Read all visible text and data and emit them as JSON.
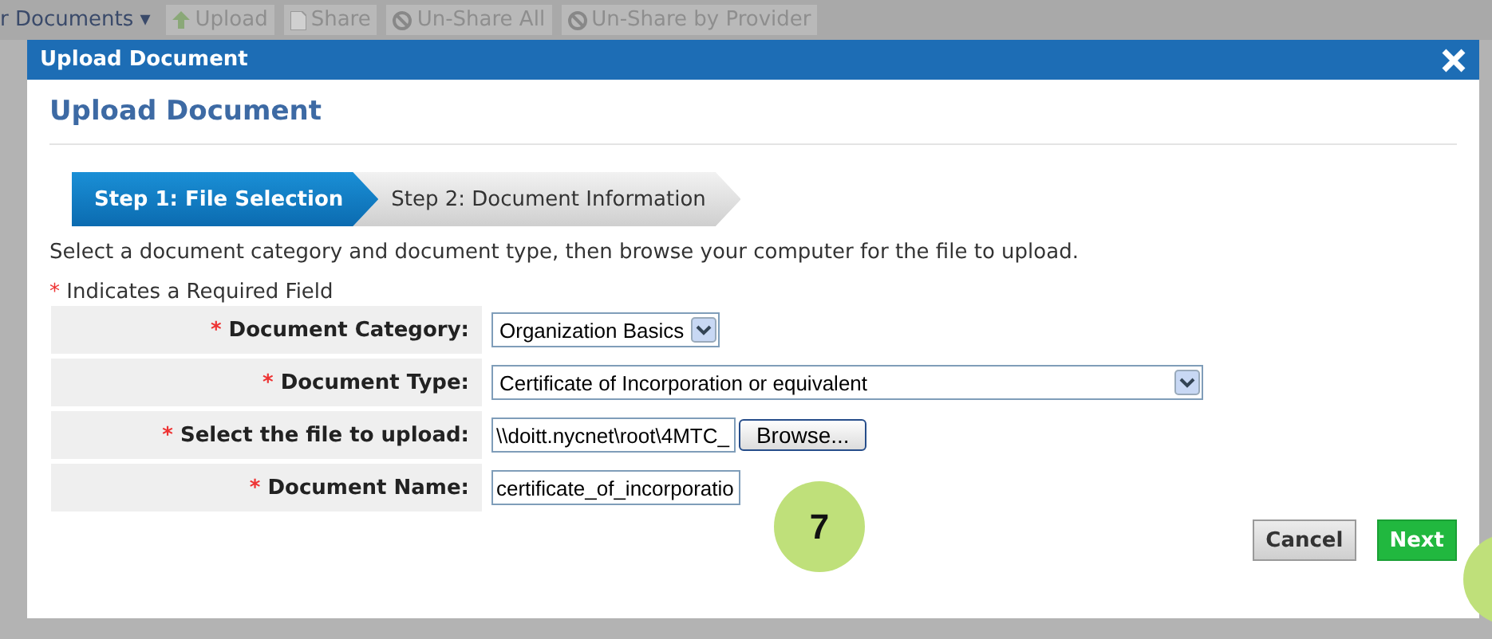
{
  "toolbar": [
    {
      "label": "r Documents ▾",
      "kind": "menu"
    },
    {
      "label": "Upload",
      "kind": "upload"
    },
    {
      "label": "Share",
      "kind": "share"
    },
    {
      "label": "Un-Share All",
      "kind": "unshare"
    },
    {
      "label": "Un-Share by Provider",
      "kind": "unshare"
    }
  ],
  "dialog": {
    "title": "Upload Document",
    "heading": "Upload Document",
    "steps": [
      {
        "label": "Step 1: File Selection",
        "selected": true
      },
      {
        "label": "Step 2: Document Information",
        "selected": false
      }
    ],
    "instructions": "Select a document category and document type, then browse your computer for the file to upload.",
    "required_note": {
      "mark": "*",
      "text": "Indicates a Required Field"
    },
    "fields": [
      {
        "label": "Document Category:",
        "required": true,
        "kind": "select",
        "value": "Organization Basics"
      },
      {
        "label": "Document Type:",
        "required": true,
        "kind": "select",
        "value": "Certificate of Incorporation or equivalent"
      },
      {
        "label": "Select the file to upload:",
        "required": true,
        "kind": "file",
        "value": "\\\\doitt.nycnet\\root\\4MTC_",
        "button": "Browse..."
      },
      {
        "label": "Document Name:",
        "required": true,
        "kind": "text",
        "value": "certificate_of_incorporatio"
      }
    ],
    "buttons": [
      {
        "label": "Cancel",
        "kind": "secondary"
      },
      {
        "label": "Next",
        "kind": "primary"
      }
    ]
  },
  "callouts": [
    {
      "label": "7"
    }
  ]
}
